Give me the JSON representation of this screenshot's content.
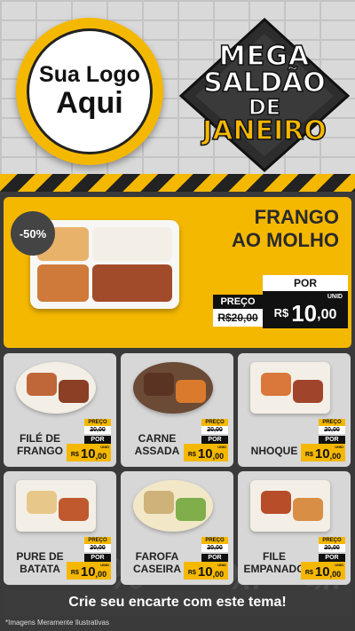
{
  "logo": {
    "line1": "Sua Logo",
    "line2": "Aqui"
  },
  "sale_badge": {
    "line1": "MEGA",
    "line2": "SALDÃO",
    "line3": "DE",
    "line4": "JANEIRO"
  },
  "featured": {
    "discount": "-50%",
    "title_line1": "FRANGO",
    "title_line2": "AO MOLHO",
    "old_label": "PREÇO",
    "old_price": "R$20,00",
    "por_label": "POR",
    "currency": "R$",
    "price_int": "10",
    "price_dec": ",00",
    "unit": "UNID"
  },
  "products": [
    {
      "name_line1": "FILÉ DE",
      "name_line2": "FRANGO",
      "old_label": "PREÇO",
      "old_price": "20,00",
      "por_label": "POR",
      "currency": "R$",
      "price_int": "10",
      "price_dec": ",00",
      "unit": "UNID"
    },
    {
      "name_line1": "CARNE",
      "name_line2": "ASSADA",
      "old_label": "PREÇO",
      "old_price": "20,00",
      "por_label": "POR",
      "currency": "R$",
      "price_int": "10",
      "price_dec": ",00",
      "unit": "UNID"
    },
    {
      "name_line1": "NHOQUE",
      "name_line2": "",
      "old_label": "PREÇO",
      "old_price": "20,00",
      "por_label": "POR",
      "currency": "R$",
      "price_int": "10",
      "price_dec": ",00",
      "unit": "UNID"
    },
    {
      "name_line1": "PURE DE",
      "name_line2": "BATATA",
      "old_label": "PREÇO",
      "old_price": "20,00",
      "por_label": "POR",
      "currency": "R$",
      "price_int": "10",
      "price_dec": ",00",
      "unit": "UNID"
    },
    {
      "name_line1": "FAROFA",
      "name_line2": "CASEIRA",
      "old_label": "PREÇO",
      "old_price": "20,00",
      "por_label": "POR",
      "currency": "R$",
      "price_int": "10",
      "price_dec": ",00",
      "unit": "UNID"
    },
    {
      "name_line1": "FILE",
      "name_line2": "EMPANADO",
      "old_label": "PREÇO",
      "old_price": "20,00",
      "por_label": "POR",
      "currency": "R$",
      "price_int": "10",
      "price_dec": ",00",
      "unit": "UNID"
    }
  ],
  "cta": "Crie seu encarte com este tema!",
  "footer_note": "*Imagens Meramente Ilustrativas",
  "colors": {
    "accent": "#f5b800",
    "dark": "#222222",
    "panel": "#d7d7d7"
  }
}
